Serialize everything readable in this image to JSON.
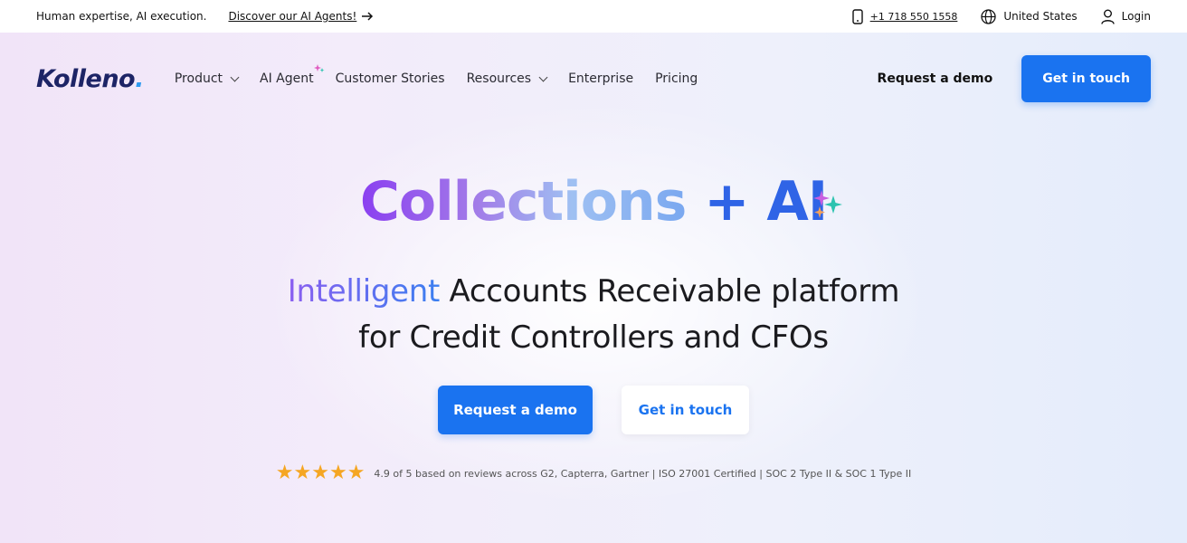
{
  "topbar": {
    "tagline": "Human expertise, AI execution.",
    "agents_link": "Discover our AI Agents!",
    "phone": "+1 718 550 1558",
    "region": "United States",
    "login": "Login"
  },
  "nav": {
    "logo": "Kolleno",
    "logo_dot": ".",
    "items": [
      {
        "label": "Product",
        "dropdown": true
      },
      {
        "label": "AI Agent",
        "dropdown": false
      },
      {
        "label": "Customer Stories",
        "dropdown": false
      },
      {
        "label": "Resources",
        "dropdown": true
      },
      {
        "label": "Enterprise",
        "dropdown": false
      },
      {
        "label": "Pricing",
        "dropdown": false
      }
    ],
    "request_demo": "Request a demo",
    "get_in_touch": "Get in touch"
  },
  "hero": {
    "headline_gradient": "Collections",
    "headline_suffix": " + AI",
    "subhead_highlight": "Intelligent",
    "subhead_line1_rest": " Accounts Receivable platform",
    "subhead_line2": "for Credit Controllers and CFOs",
    "primary_button": "Request a demo",
    "secondary_button": "Get in touch",
    "stars": "★★★★★",
    "rating_text": "4.9 of 5 based on reviews across G2, Capterra, Gartner | ISO 27001 Certified | SOC 2 Type II & SOC 1 Type II"
  },
  "colors": {
    "primary": "#1a73f0",
    "logo": "#1d2466",
    "star": "#f5a623"
  },
  "icons": [
    "arrow-right-icon",
    "phone-icon",
    "globe-icon",
    "user-icon",
    "chevron-down-icon",
    "sparkle-icon",
    "star-icon"
  ]
}
